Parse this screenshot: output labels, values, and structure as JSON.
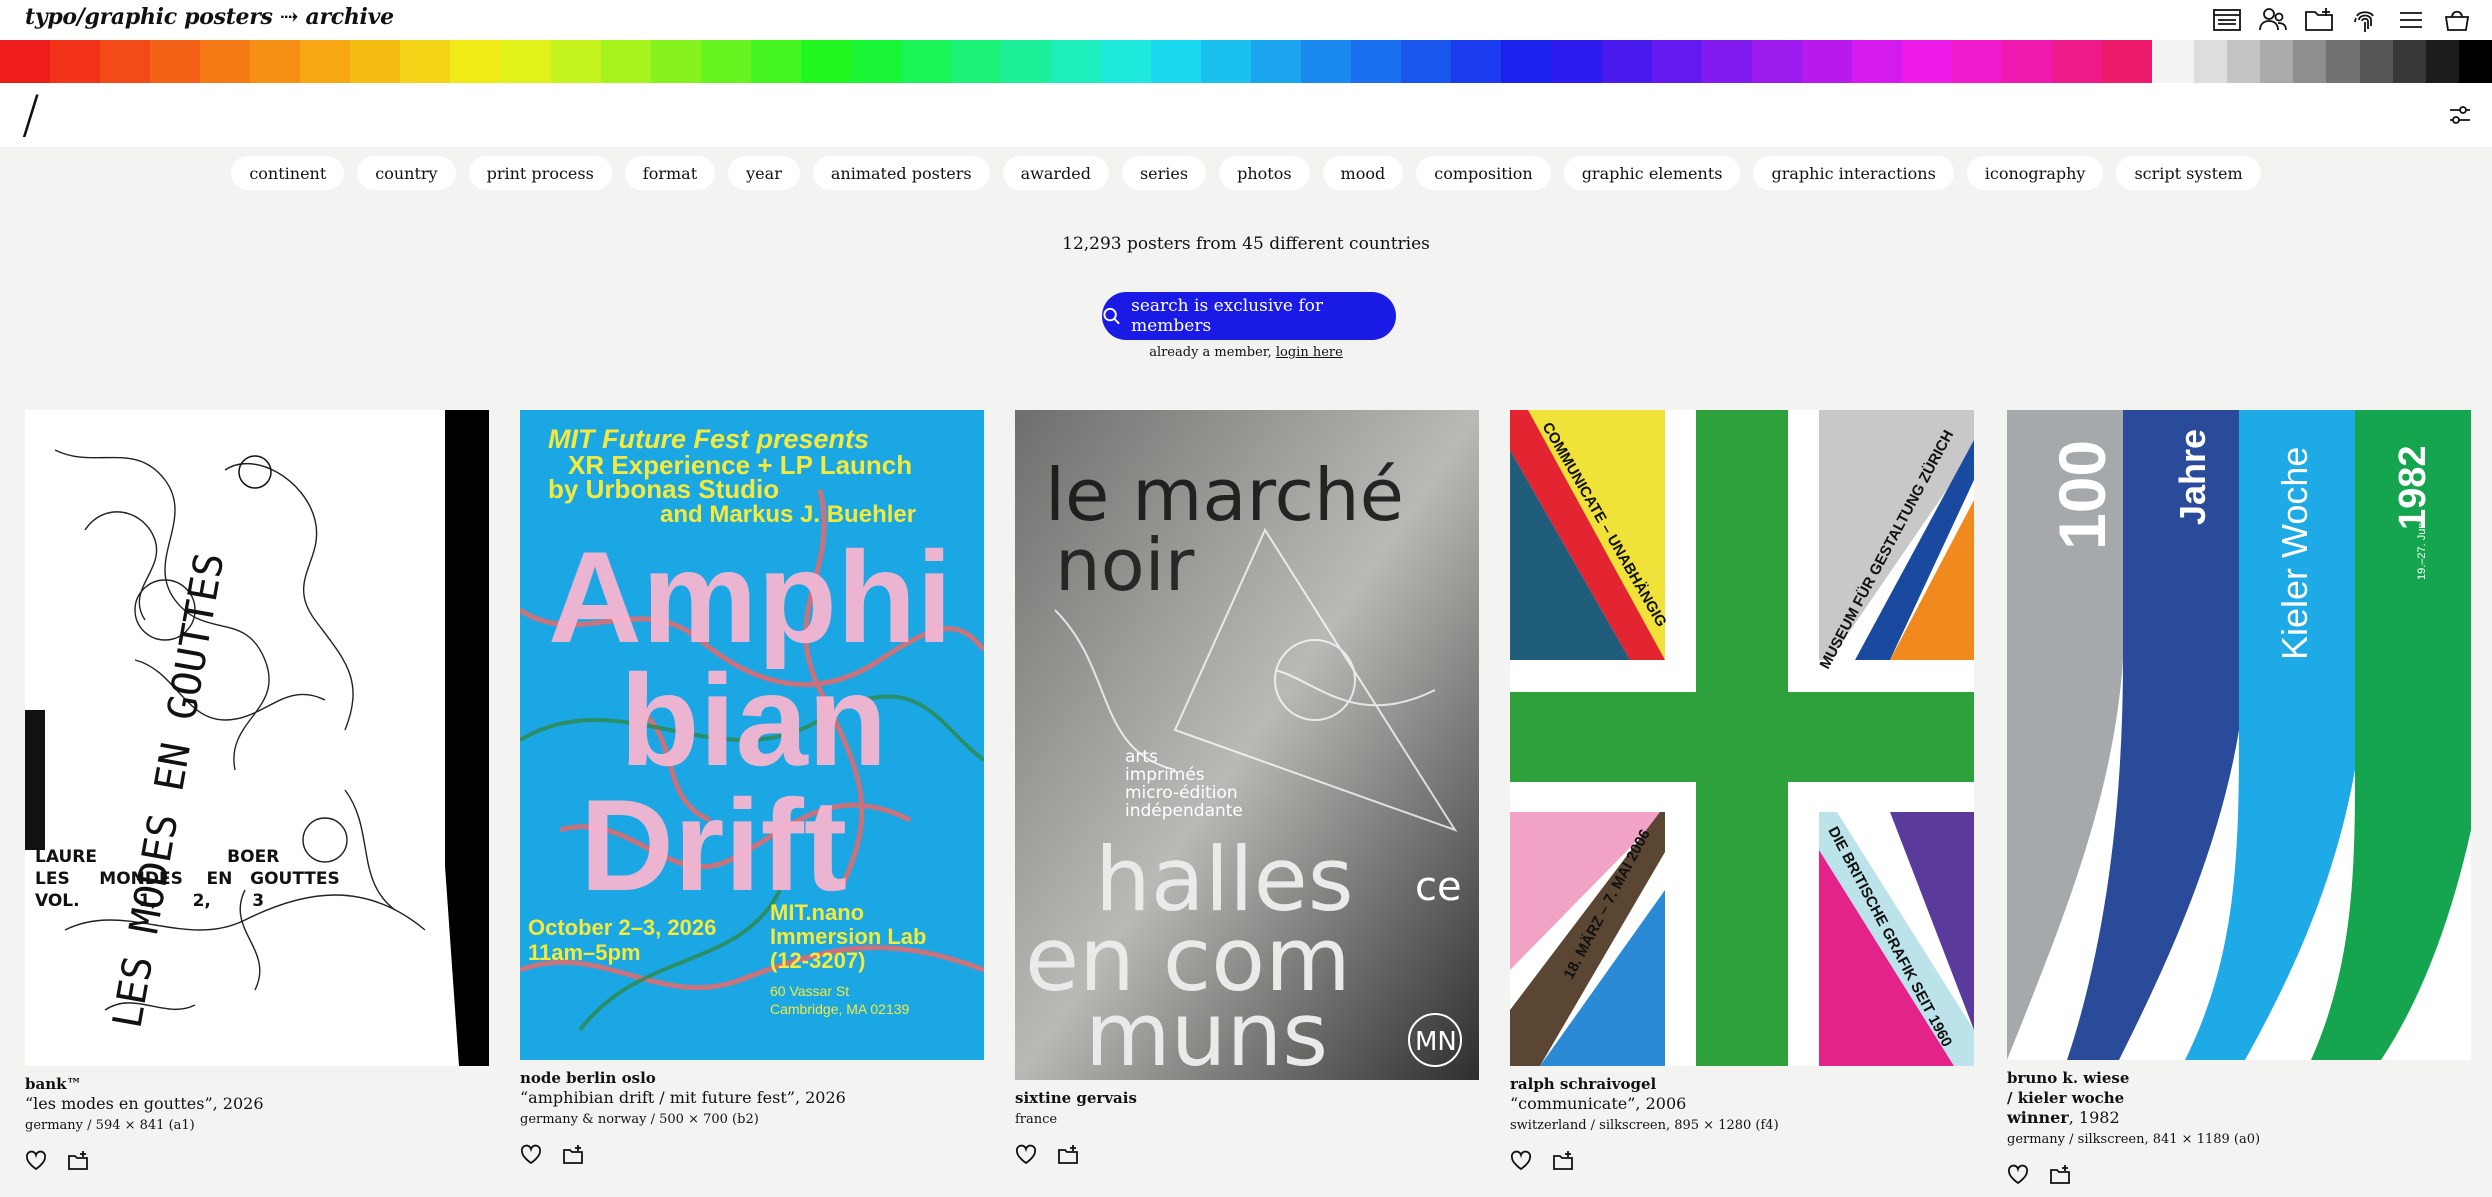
{
  "header": {
    "logo": "typo/graphic posters ⇢ archive",
    "icons": [
      "poster-card-icon",
      "user-group-icon",
      "add-folder-icon",
      "fingerprint-icon",
      "menu-icon",
      "basket-icon"
    ]
  },
  "palette": {
    "colors": [
      "#ef1c1c",
      "#f2331a",
      "#f34b18",
      "#f46217",
      "#f57a15",
      "#f69014",
      "#f6a713",
      "#f5bd14",
      "#f3d416",
      "#f0ea17",
      "#e0f219",
      "#c4f21c",
      "#a6f31d",
      "#86f31e",
      "#65f41f",
      "#44f520",
      "#22f621",
      "#1af536",
      "#1af456",
      "#1cf278",
      "#1ef09a",
      "#1eedbc",
      "#1ee9dc",
      "#1bd9ee",
      "#1ac0ee",
      "#1aa5ee",
      "#1a8aee",
      "#1a70ee",
      "#1a56ee",
      "#1a3cee",
      "#1a22ee",
      "#2c1aee",
      "#481aee",
      "#641aee",
      "#801aee",
      "#9c1aee",
      "#b81aee",
      "#d41aee",
      "#ee1ae8",
      "#ee1acc",
      "#ee1ab0",
      "#ee1a8c",
      "#ee1a6c"
    ],
    "greys": [
      "#dddddd",
      "#c4c4c4",
      "#aaaaaa",
      "#8e8e8e",
      "#727272",
      "#555555",
      "#383838",
      "#1c1c1c",
      "#000000"
    ]
  },
  "search": {
    "placeholder": "/",
    "filter_icon": "sliders-icon"
  },
  "filters": [
    "continent",
    "country",
    "print process",
    "format",
    "year",
    "animated posters",
    "awarded",
    "series",
    "photos",
    "mood",
    "composition",
    "graphic elements",
    "graphic interactions",
    "iconography",
    "script system"
  ],
  "stats": "12,293 posters from 45 different countries",
  "cta": {
    "label": "search is exclusive for members"
  },
  "member": {
    "text": "already a member, ",
    "link": "login here"
  },
  "posters": [
    {
      "artist": "bank™",
      "title": "“les modes en gouttes”, 2026",
      "spec": "germany / 594 × 841 (a1)",
      "print": {
        "rotated": "LES MODES EN GOUTTES",
        "line1": "LAURE                      BOER",
        "line2": "LES     MONDES    EN   GOUTTES",
        "line3": "VOL.          1,      2,       3"
      }
    },
    {
      "artist": "node berlin oslo",
      "title": "“amphibian drift / mit future fest”, 2026",
      "spec": "germany & norway / 500 × 700 (b2)",
      "print": {
        "head1": "MIT Future Fest presents",
        "head2": "XR Experience + LP Launch",
        "head3": "by Urbonas Studio",
        "head4": "and Markus J. Buehler",
        "big1": "Amphi",
        "big2": "bian",
        "big3": "Drift",
        "date1": "October 2–3, 2026",
        "date2": "11am–5pm",
        "venue1": "MIT.nano",
        "venue2": "Immersion Lab",
        "venue3": "(12-3207)",
        "addr1": "60 Vassar St",
        "addr2": "Cambridge, MA 02139"
      }
    },
    {
      "artist": "sixtine gervais",
      "title": "",
      "spec": "france",
      "print": {
        "t1": "le marché",
        "t2": "noir",
        "t3": "arts",
        "t4": "imprimés",
        "t5": "micro-édition",
        "t6": "indépendante",
        "t7": "halles",
        "t8": "en com",
        "t9": "muns",
        "mark": "MN",
        "mark2": "ce"
      }
    },
    {
      "artist": "ralph schraivogel",
      "title": "“communicate”, 2006",
      "spec": "switzerland / silkscreen, 895 × 1280 (f4)",
      "print": {
        "a": "COMMUNICATE – UNABHÄNGIG",
        "b": "MUSEUM FÜR GESTALTUNG ZÜRICH",
        "c": "18. MÄRZ – 7. MAI 2006",
        "d": "DIE BRITISCHE GRAFIK SEIT 1960"
      }
    },
    {
      "artist": "bruno k. wiese",
      "artist2": "/ kieler woche",
      "artist3": "winner",
      "title": ", 1982",
      "spec": "germany / silkscreen, 841 × 1189 (a0)",
      "print": {
        "a": "100",
        "b": "Jahre",
        "c": "Kieler Woche",
        "d": "1982",
        "e": "19.–27. Juni"
      }
    }
  ]
}
